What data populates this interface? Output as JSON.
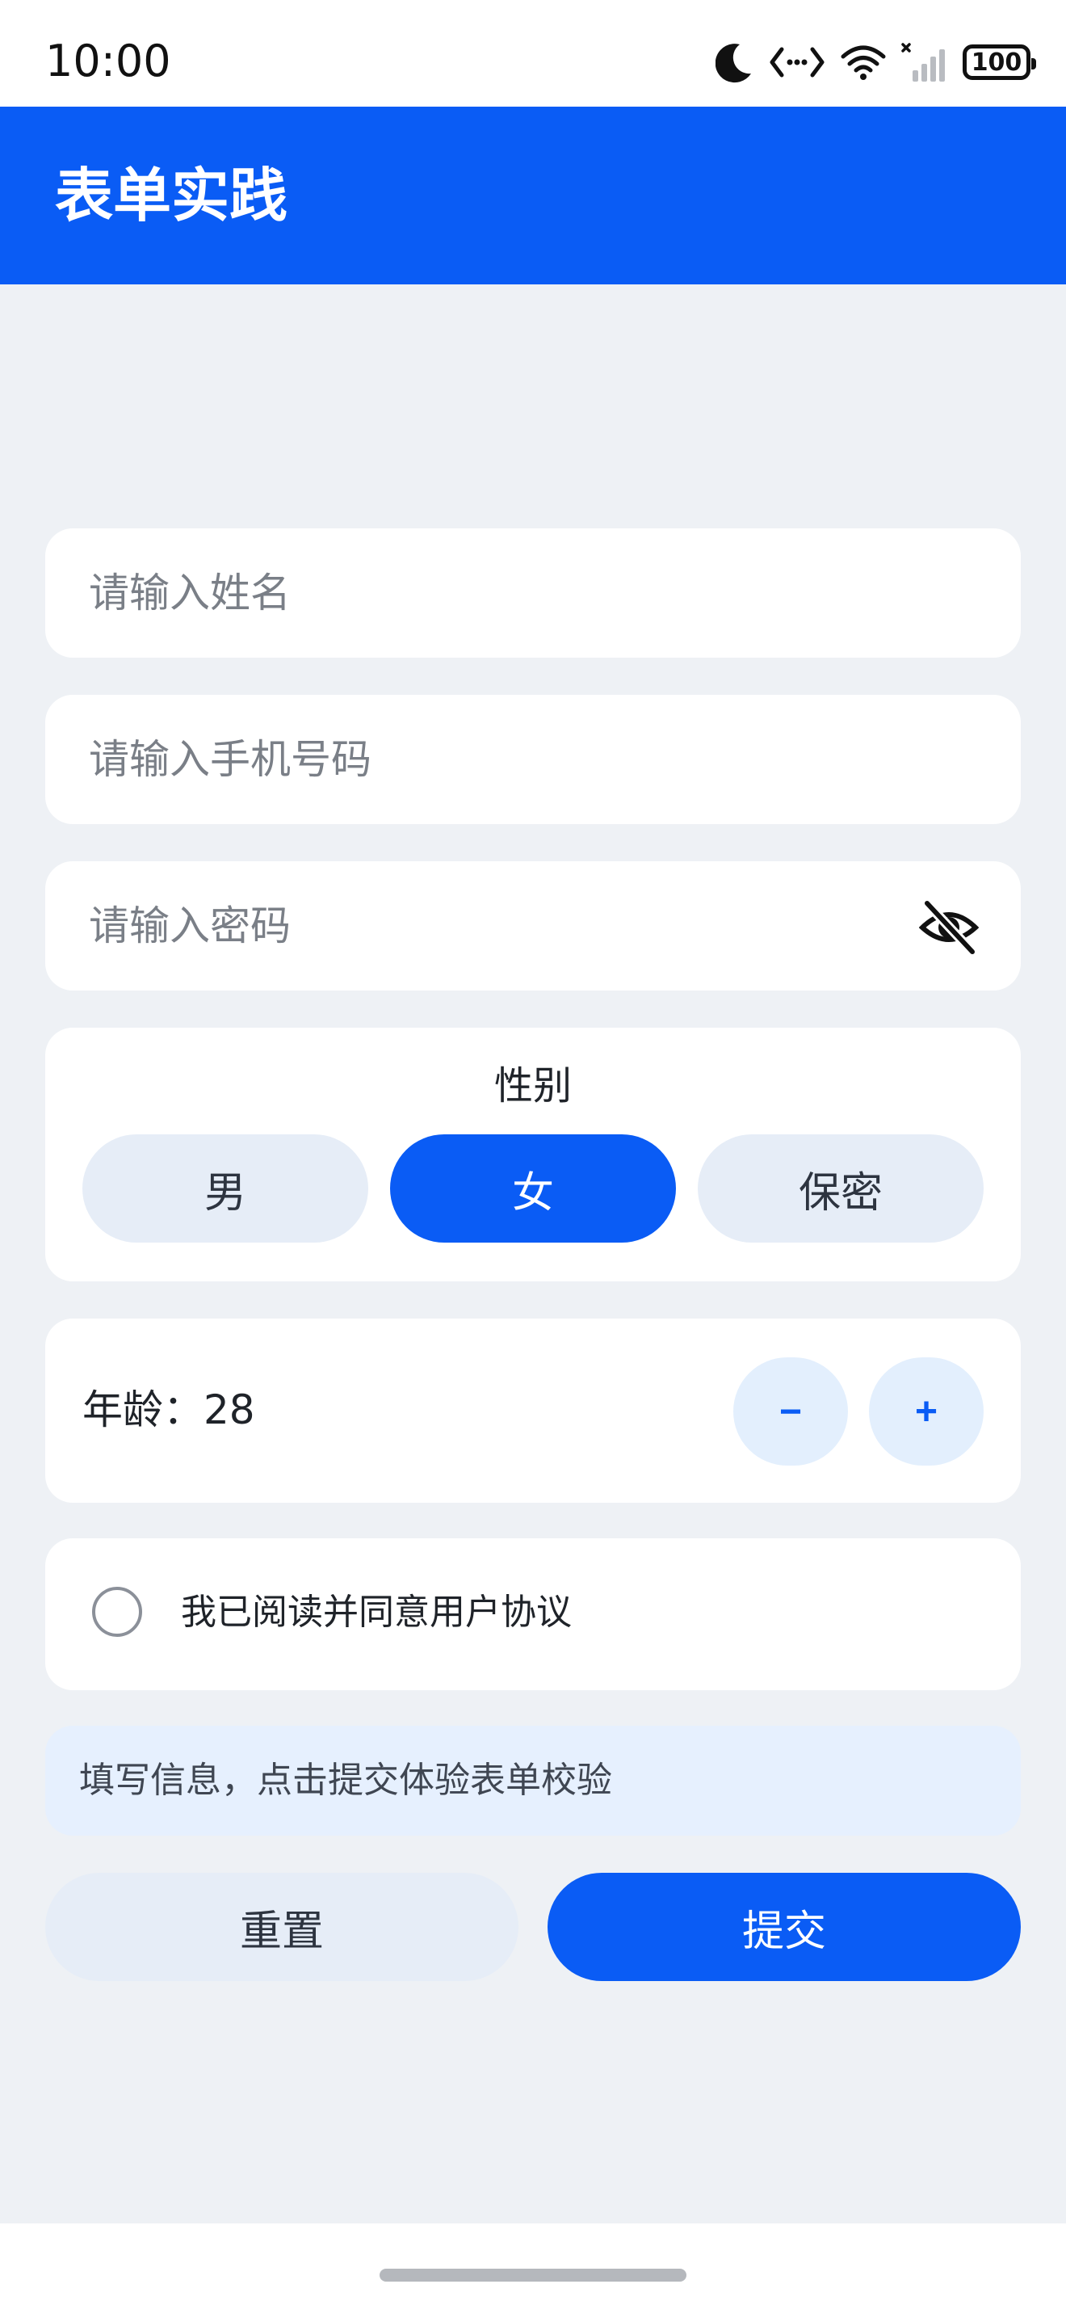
{
  "status_bar": {
    "time": "10:00",
    "battery": "100",
    "icons": [
      "moon-icon",
      "data-transfer-icon",
      "wifi-icon",
      "cellular-signal-icon",
      "battery-icon"
    ]
  },
  "app_bar": {
    "title": "表单实践",
    "color": "#0a5cf5"
  },
  "form": {
    "name_placeholder": "请输入姓名",
    "phone_placeholder": "请输入手机号码",
    "password_placeholder": "请输入密码",
    "password_toggle_icon": "eye-off-icon"
  },
  "gender": {
    "title": "性别",
    "options": [
      "男",
      "女",
      "保密"
    ],
    "selected": "女"
  },
  "age": {
    "label": "年龄：",
    "value": "28",
    "decrement": "−",
    "increment": "+"
  },
  "agreement": {
    "label": "我已阅读并同意用户协议",
    "checked": false
  },
  "hint": "填写信息，点击提交体验表单校验",
  "actions": {
    "reset": "重置",
    "submit": "提交"
  }
}
